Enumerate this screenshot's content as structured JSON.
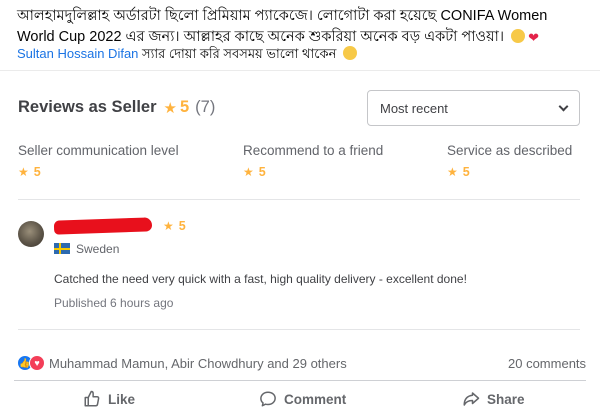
{
  "post": {
    "text": "আলহামদুলিল্লাহ অর্ডারটা ছিলো প্রিমিয়াম প্যাকেজে। লোগোটা করা হয়েছে CONIFA Women World Cup 2022 এর জন্য। আল্লাহর কাছে অনেক শুকরিয়া অনেক বড় একটা পাওয়া।",
    "mention_name": "Sultan Hossain Difan",
    "mention_text": "স্যার দোয়া করি সবসময় ভালো থাকেন"
  },
  "reviews": {
    "title": "Reviews as Seller",
    "rating": "5",
    "count": "(7)",
    "sort_selected": "Most recent",
    "criteria": [
      {
        "label": "Seller communication level",
        "value": "5"
      },
      {
        "label": "Recommend to a friend",
        "value": "5"
      },
      {
        "label": "Service as described",
        "value": "5"
      }
    ],
    "review": {
      "rating": "5",
      "country": "Sweden",
      "text": "Catched the need very quick with a fast, high quality delivery - excellent done!",
      "published": "Published 6 hours ago"
    }
  },
  "footer": {
    "reactors": "Muhammad Mamun, Abir Chowdhury and 29 others",
    "comments": "20 comments",
    "like_label": "Like",
    "comment_label": "Comment",
    "share_label": "Share"
  },
  "colors": {
    "star": "#ffb33e",
    "link": "#1b74e4",
    "redaction": "#e8101c"
  }
}
